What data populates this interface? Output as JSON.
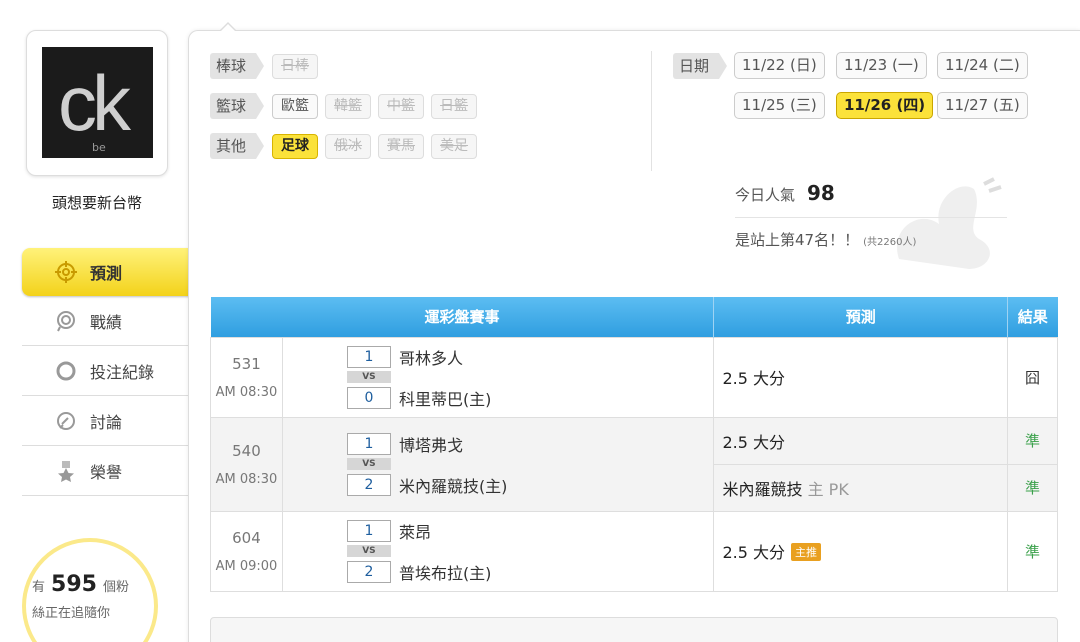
{
  "profile": {
    "avatar_main": "ck",
    "avatar_sub": "be",
    "username": "頭想要新台幣"
  },
  "nav": [
    {
      "label": "預測",
      "icon": "target-icon",
      "active": true
    },
    {
      "label": "戰績",
      "icon": "medal-icon",
      "active": false
    },
    {
      "label": "投注紀錄",
      "icon": "circle-icon",
      "active": false
    },
    {
      "label": "討論",
      "icon": "discussion-icon",
      "active": false
    },
    {
      "label": "榮譽",
      "icon": "honor-icon",
      "active": false
    }
  ],
  "fans": {
    "prefix": "有",
    "count": "595",
    "suffix": "個粉",
    "line2": "絲正在追隨你"
  },
  "categories": {
    "baseball": {
      "label": "棒球",
      "items": [
        {
          "label": "日棒",
          "state": "off"
        }
      ]
    },
    "basketball": {
      "label": "籃球",
      "items": [
        {
          "label": "歐籃",
          "state": "normal"
        },
        {
          "label": "韓籃",
          "state": "off"
        },
        {
          "label": "中籃",
          "state": "off"
        },
        {
          "label": "日籃",
          "state": "off"
        }
      ]
    },
    "other": {
      "label": "其他",
      "items": [
        {
          "label": "足球",
          "state": "on"
        },
        {
          "label": "俄冰",
          "state": "off"
        },
        {
          "label": "賽馬",
          "state": "off"
        },
        {
          "label": "美足",
          "state": "off"
        }
      ]
    }
  },
  "dates": {
    "label": "日期",
    "items": [
      {
        "label": "11/22 (日)",
        "active": false
      },
      {
        "label": "11/23 (一)",
        "active": false
      },
      {
        "label": "11/24 (二)",
        "active": false
      },
      {
        "label": "11/25 (三)",
        "active": false
      },
      {
        "label": "11/26 (四)",
        "active": true
      },
      {
        "label": "11/27 (五)",
        "active": false
      }
    ]
  },
  "popularity": {
    "label": "今日人氣",
    "value": "98",
    "rank_text": "是站上第47名！！",
    "total": "(共2260人)"
  },
  "table": {
    "headers": {
      "event": "運彩盤賽事",
      "prediction": "預測",
      "result": "結果"
    },
    "vs": "VS",
    "games": [
      {
        "no": "531",
        "time": "AM 08:30",
        "home_score": "1",
        "away_score": "0",
        "team1": "哥林多人",
        "team2": "科里蒂巴(主)",
        "predictions": [
          {
            "text": "2.5 大分",
            "result": "囧",
            "status": "neutral"
          }
        ]
      },
      {
        "no": "540",
        "time": "AM 08:30",
        "home_score": "1",
        "away_score": "2",
        "team1": "博塔弗戈",
        "team2": "米內羅競技(主)",
        "predictions": [
          {
            "text": "2.5 大分",
            "result": "準",
            "status": "good"
          },
          {
            "text": "米內羅競技",
            "extra": "主 PK",
            "result": "準",
            "status": "good"
          }
        ]
      },
      {
        "no": "604",
        "time": "AM 09:00",
        "home_score": "1",
        "away_score": "2",
        "team1": "萊昂",
        "team2": "普埃布拉(主)",
        "predictions": [
          {
            "text": "2.5 大分",
            "badge": "主推",
            "result": "準",
            "status": "good"
          }
        ]
      }
    ]
  },
  "colors": {
    "accent_yellow": "#fbe23a",
    "header_blue": "#2f9ee0",
    "good_green": "#3aa04a",
    "badge_orange": "#e9a020"
  }
}
